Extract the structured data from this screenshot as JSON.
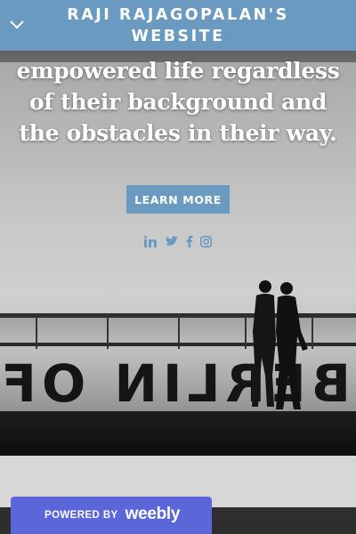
{
  "header": {
    "site_title": "RAJI RAJAGOPALAN'S WEBSITE",
    "menu_icon": "chevron-down-icon"
  },
  "hero": {
    "text": "empowered life regardless of their background and the obstacles in their way.",
    "cta_label": "LEARN MORE",
    "background_signage": "BERLIN OF L",
    "social_icons": [
      "linkedin-icon",
      "twitter-icon",
      "facebook-icon",
      "instagram-icon"
    ]
  },
  "badge": {
    "powered_label": "POWERED BY",
    "brand": "weebly"
  },
  "colors": {
    "accent": "#6b9ac1",
    "badge": "#5b67d9",
    "footer": "#2e2e2e"
  }
}
